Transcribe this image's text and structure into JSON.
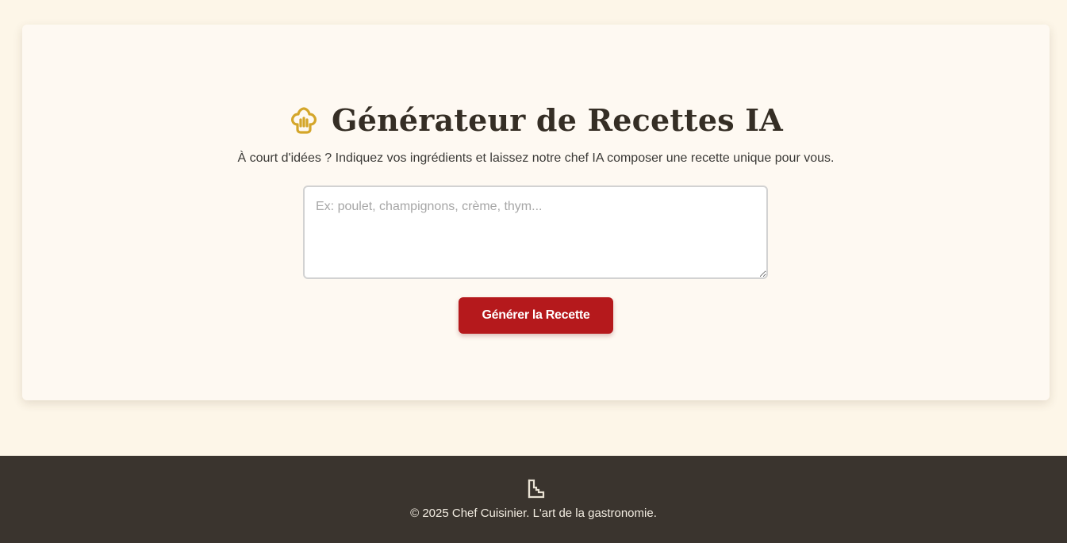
{
  "header": {
    "title": "Générateur de Recettes IA",
    "icon": "chef-hat-icon",
    "subtitle": "À court d'idées ? Indiquez vos ingrédients et laissez notre chef IA composer une recette unique pour vous."
  },
  "form": {
    "ingredients_value": "",
    "ingredients_placeholder": "Ex: poulet, champignons, crème, thym...",
    "generate_label": "Générer la Recette"
  },
  "footer": {
    "icon": "boot-icon",
    "copyright": "© 2025 Chef Cuisinier. L'art de la gastronomie."
  },
  "colors": {
    "page_background": "#fdf6e8",
    "card_background": "#fef9f2",
    "accent_gold": "#d4a62a",
    "button_red": "#b5191c",
    "footer_background": "#3a342e",
    "title_text": "#352e25"
  }
}
